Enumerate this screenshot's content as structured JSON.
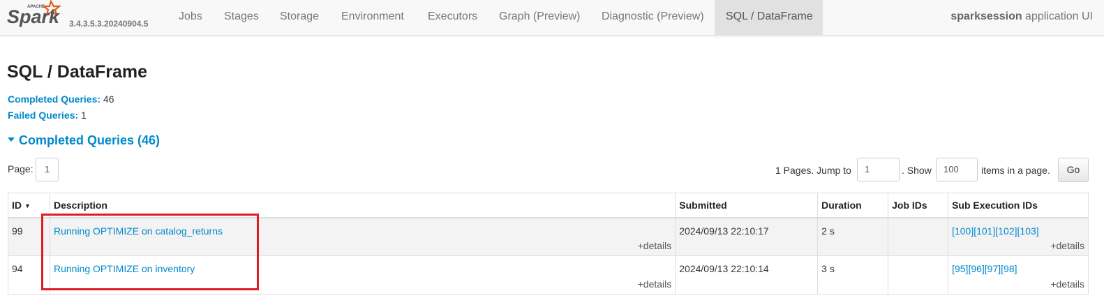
{
  "navbar": {
    "brand_top": "APACHE",
    "brand_name": "Spark",
    "version": "3.4.3.5.3.20240904.5",
    "tabs": [
      {
        "label": "Jobs"
      },
      {
        "label": "Stages"
      },
      {
        "label": "Storage"
      },
      {
        "label": "Environment"
      },
      {
        "label": "Executors"
      },
      {
        "label": "Graph (Preview)"
      },
      {
        "label": "Diagnostic (Preview)"
      },
      {
        "label": "SQL / DataFrame",
        "active": true
      }
    ],
    "app_name": "sparksession",
    "app_suffix": " application UI"
  },
  "page": {
    "title": "SQL / DataFrame",
    "completed_label": "Completed Queries:",
    "completed_value": "46",
    "failed_label": "Failed Queries:",
    "failed_value": "1",
    "section_title": "Completed Queries (46)"
  },
  "pagination": {
    "page_label": "Page:",
    "current_page": "1",
    "pages_text": "1 Pages. Jump to",
    "jump_value": "1",
    "show_text": ". Show",
    "show_value": "100",
    "items_text": "items in a page.",
    "go_label": "Go"
  },
  "table": {
    "headers": {
      "id": "ID",
      "sort_arrow": "▼",
      "description": "Description",
      "submitted": "Submitted",
      "duration": "Duration",
      "job_ids": "Job IDs",
      "sub_execution_ids": "Sub Execution IDs"
    },
    "details_label": "+details",
    "rows": [
      {
        "id": "99",
        "description": "Running OPTIMIZE on catalog_returns",
        "submitted": "2024/09/13 22:10:17",
        "duration": "2 s",
        "job_ids": "",
        "sub_execution_ids": [
          "[100]",
          "[101]",
          "[102]",
          "[103]"
        ]
      },
      {
        "id": "94",
        "description": "Running OPTIMIZE on inventory",
        "submitted": "2024/09/13 22:10:14",
        "duration": "3 s",
        "job_ids": "",
        "sub_execution_ids": [
          "[95]",
          "[96]",
          "[97]",
          "[98]"
        ]
      }
    ]
  },
  "colors": {
    "link": "#0088cc",
    "highlight": "#e01b24",
    "spark_orange": "#e25a1c"
  }
}
